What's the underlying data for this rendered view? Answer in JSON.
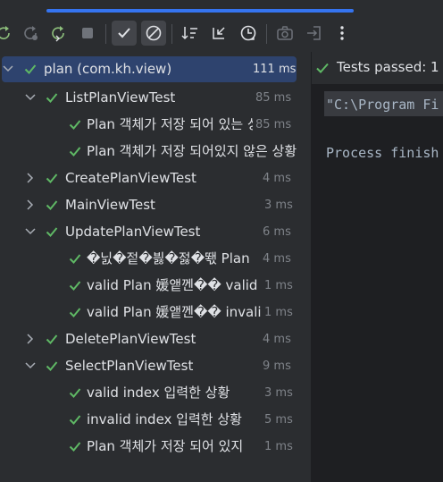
{
  "colors": {
    "accent": "#3574f0",
    "pass": "#5fb865",
    "selection": "#2e436e",
    "panel_bg": "#2b2d30",
    "console_bg": "#1e1f22"
  },
  "toolbar": {
    "icons": [
      "rerun-icon",
      "rerun-failed-icon",
      "toggle-auto-test-icon",
      "stop-icon",
      "show-passed-icon",
      "show-ignored-icon",
      "sort-icon",
      "collapse-icon",
      "sort-by-duration-icon",
      "snapshot-icon",
      "export-icon",
      "more-icon"
    ]
  },
  "tree": {
    "root": {
      "label": "plan (com.kh.view)",
      "time": "111 ms"
    },
    "list_plan": {
      "label": "ListPlanViewTest",
      "time": "85 ms"
    },
    "list_plan_1": {
      "label": "Plan 객체가 저장 되어 있는 상황",
      "time": "85 ms"
    },
    "list_plan_2": {
      "label": "Plan 객체가 저장 되어있지 않은 상황",
      "time": ""
    },
    "create_plan": {
      "label": "CreatePlanViewTest",
      "time": "4 ms"
    },
    "main_view": {
      "label": "MainViewTest",
      "time": "3 ms"
    },
    "update_plan": {
      "label": "UpdatePlanViewTest",
      "time": "6 ms"
    },
    "update_plan_1": {
      "label": "�닔�젙�븷�젏�뙋 Plan",
      "time": "4 ms"
    },
    "update_plan_2": {
      "label": "valid Plan 媛앹껜�� valid",
      "time": "1 ms"
    },
    "update_plan_3": {
      "label": "valid Plan 媛앹껜�� invalid",
      "time": "1 ms"
    },
    "delete_plan": {
      "label": "DeletePlanViewTest",
      "time": "4 ms"
    },
    "select_plan": {
      "label": "SelectPlanViewTest",
      "time": "9 ms"
    },
    "select_plan_1": {
      "label": "valid index 입력한 상황",
      "time": "3 ms"
    },
    "select_plan_2": {
      "label": "invalid index 입력한 상황",
      "time": "5 ms"
    },
    "select_plan_3": {
      "label": "Plan 객체가 저장 되어 있지",
      "time": "1 ms"
    }
  },
  "console": {
    "status": "Tests passed: 1",
    "command": "\"C:\\Program Fi",
    "process": "Process finish"
  }
}
